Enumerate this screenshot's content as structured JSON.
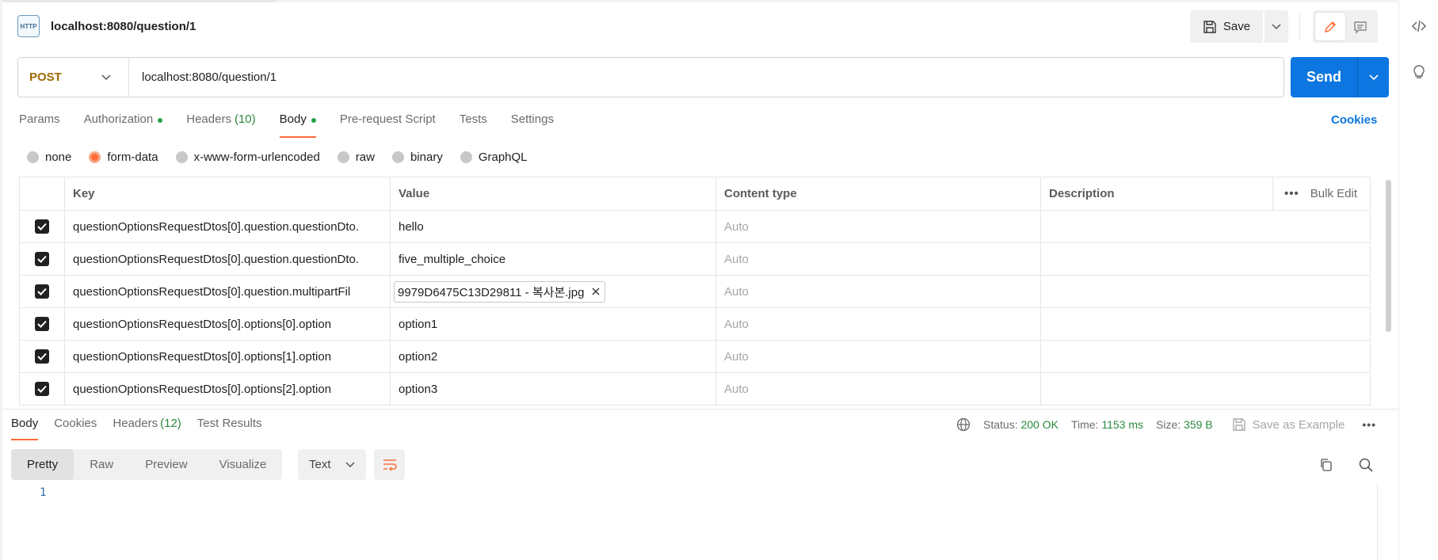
{
  "request": {
    "title": "localhost:8080/question/1",
    "icon_label": "HTTP",
    "save_label": "Save",
    "method": "POST",
    "url": "localhost:8080/question/1",
    "send_label": "Send"
  },
  "request_tabs": [
    {
      "label": "Params",
      "count": "",
      "dot": false,
      "active": false
    },
    {
      "label": "Authorization",
      "count": "",
      "dot": true,
      "active": false
    },
    {
      "label": "Headers",
      "count": "(10)",
      "dot": false,
      "active": false
    },
    {
      "label": "Body",
      "count": "",
      "dot": true,
      "active": true
    },
    {
      "label": "Pre-request Script",
      "count": "",
      "dot": false,
      "active": false
    },
    {
      "label": "Tests",
      "count": "",
      "dot": false,
      "active": false
    },
    {
      "label": "Settings",
      "count": "",
      "dot": false,
      "active": false
    }
  ],
  "cookies_label": "Cookies",
  "body_types": {
    "none": "none",
    "form_data": "form-data",
    "urlencoded": "x-www-form-urlencoded",
    "raw": "raw",
    "binary": "binary",
    "graphql": "GraphQL",
    "selected": "form-data"
  },
  "form_table": {
    "headers": {
      "key": "Key",
      "value": "Value",
      "content_type": "Content type",
      "description": "Description",
      "bulk_edit": "Bulk Edit"
    },
    "rows": [
      {
        "key": "questionOptionsRequestDtos[0].question.questionDto.",
        "value": "hello",
        "content_type": "Auto",
        "checked": true
      },
      {
        "key": "questionOptionsRequestDtos[0].question.questionDto.",
        "value": "five_multiple_choice",
        "content_type": "Auto",
        "checked": true
      },
      {
        "key": "questionOptionsRequestDtos[0].question.multipartFil",
        "value": "9979D6475C13D29811 - 복사본.jpg",
        "content_type": "Auto",
        "checked": true
      },
      {
        "key": "questionOptionsRequestDtos[0].options[0].option",
        "value": "option1",
        "content_type": "Auto",
        "checked": true
      },
      {
        "key": "questionOptionsRequestDtos[0].options[1].option",
        "value": "option2",
        "content_type": "Auto",
        "checked": true
      },
      {
        "key": "questionOptionsRequestDtos[0].options[2].option",
        "value": "option3",
        "content_type": "Auto",
        "checked": true
      }
    ]
  },
  "response": {
    "tabs": [
      {
        "label": "Body",
        "count": "",
        "active": true
      },
      {
        "label": "Cookies",
        "count": "",
        "active": false
      },
      {
        "label": "Headers",
        "count": "(12)",
        "active": false
      },
      {
        "label": "Test Results",
        "count": "",
        "active": false
      }
    ],
    "status_label": "Status:",
    "status_value": "200 OK",
    "time_label": "Time:",
    "time_value": "1153 ms",
    "size_label": "Size:",
    "size_value": "359 B",
    "save_example": "Save as Example",
    "views": [
      "Pretty",
      "Raw",
      "Preview",
      "Visualize"
    ],
    "active_view": "Pretty",
    "format": "Text",
    "line_number": "1"
  },
  "colors": {
    "accent": "#ff6c37",
    "send": "#0d76e0",
    "method": "#a06a00",
    "status_ok": "#2a8a3d"
  }
}
